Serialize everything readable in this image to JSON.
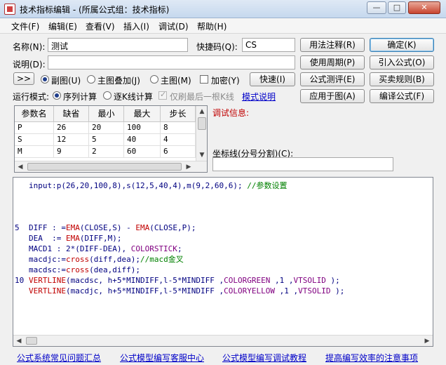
{
  "window": {
    "title": "技术指标编辑 - (所属公式组：技术指标)",
    "minimize": "—",
    "maximize": "□",
    "close": "✕"
  },
  "menu": [
    "文件(F)",
    "编辑(E)",
    "查看(V)",
    "插入(I)",
    "调试(D)",
    "帮助(H)"
  ],
  "form": {
    "name_label": "名称(N):",
    "name_value": "测试",
    "hotkey_label": "快捷码(Q):",
    "hotkey_value": "CS",
    "desc_label": "说明(D):",
    "desc_value": "",
    "expand_button": ">>",
    "radio_sub": "副图(U)",
    "radio_main_overlay": "主图叠加(J)",
    "radio_main": "主图(M)",
    "encrypt": "加密(Y)",
    "quick_button": "快速(I)",
    "run_mode_label": "运行模式:",
    "run_seq": "序列计算",
    "run_step": "逐K线计算",
    "last_only": "仅刷最后一根K线",
    "mode_help": "模式说明"
  },
  "buttons": {
    "usage_note": "用法注释(R)",
    "confirm": "确定(K)",
    "use_period": "使用周期(P)",
    "import_formula": "引入公式(O)",
    "formula_test": "公式测评(E)",
    "trade_rules": "买卖规则(B)",
    "apply_to_chart": "应用于图(A)",
    "compile": "编译公式(F)"
  },
  "params": {
    "headers": [
      "参数名",
      "缺省",
      "最小",
      "最大",
      "步长"
    ],
    "rows": [
      [
        "P",
        "26",
        "20",
        "100",
        "8"
      ],
      [
        "S",
        "12",
        "5",
        "40",
        "4"
      ],
      [
        "M",
        "9",
        "2",
        "60",
        "6"
      ]
    ]
  },
  "debug": {
    "label": "调试信息:",
    "axis_label": "坐标线(分号分割)(C):",
    "axis_value": ""
  },
  "code": {
    "lines": [
      {
        "num": "",
        "html": "input:p(26,20,100,8),s(12,5,40,4),m(9,2,60,6); <span class=\"cm\">//参数设置</span>"
      },
      {
        "num": "",
        "html": ""
      },
      {
        "num": "",
        "html": ""
      },
      {
        "num": "",
        "html": ""
      },
      {
        "num": "5",
        "html": "DIFF : =<span class=\"fn\">EMA</span>(CLOSE,S) - <span class=\"fn\">EMA</span>(CLOSE,P);"
      },
      {
        "num": "",
        "html": "DEA  := <span class=\"fn\">EMA</span>(DIFF,M);"
      },
      {
        "num": "",
        "html": "MACD1 : 2*(DIFF-DEA), <span class=\"cn\">COLORSTICK</span>;"
      },
      {
        "num": "",
        "html": "macdjc:=<span class=\"fn\">cross</span>(diff,dea);<span class=\"cm\">//macd金叉</span>"
      },
      {
        "num": "",
        "html": "macdsc:=<span class=\"fn\">cross</span>(dea,diff);"
      },
      {
        "num": "10",
        "html": "<span class=\"fn\">VERTLINE</span>(macdsc, h+5*MINDIFF,l-5*MINDIFF ,<span class=\"cn\">COLORGREEN</span> ,1 ,<span class=\"cn\">VTSOLID</span> );"
      },
      {
        "num": "",
        "html": "<span class=\"fn\">VERTLINE</span>(macdjc, h+5*MINDIFF,l-5*MINDIFF ,<span class=\"cn\">COLORYELLOW</span> ,1 ,<span class=\"cn\">VTSOLID</span> );"
      }
    ]
  },
  "footer_links": [
    "公式系统常见问题汇总",
    "公式模型编写客服中心",
    "公式模型编写调试教程",
    "提高编写效率的注意事项"
  ]
}
